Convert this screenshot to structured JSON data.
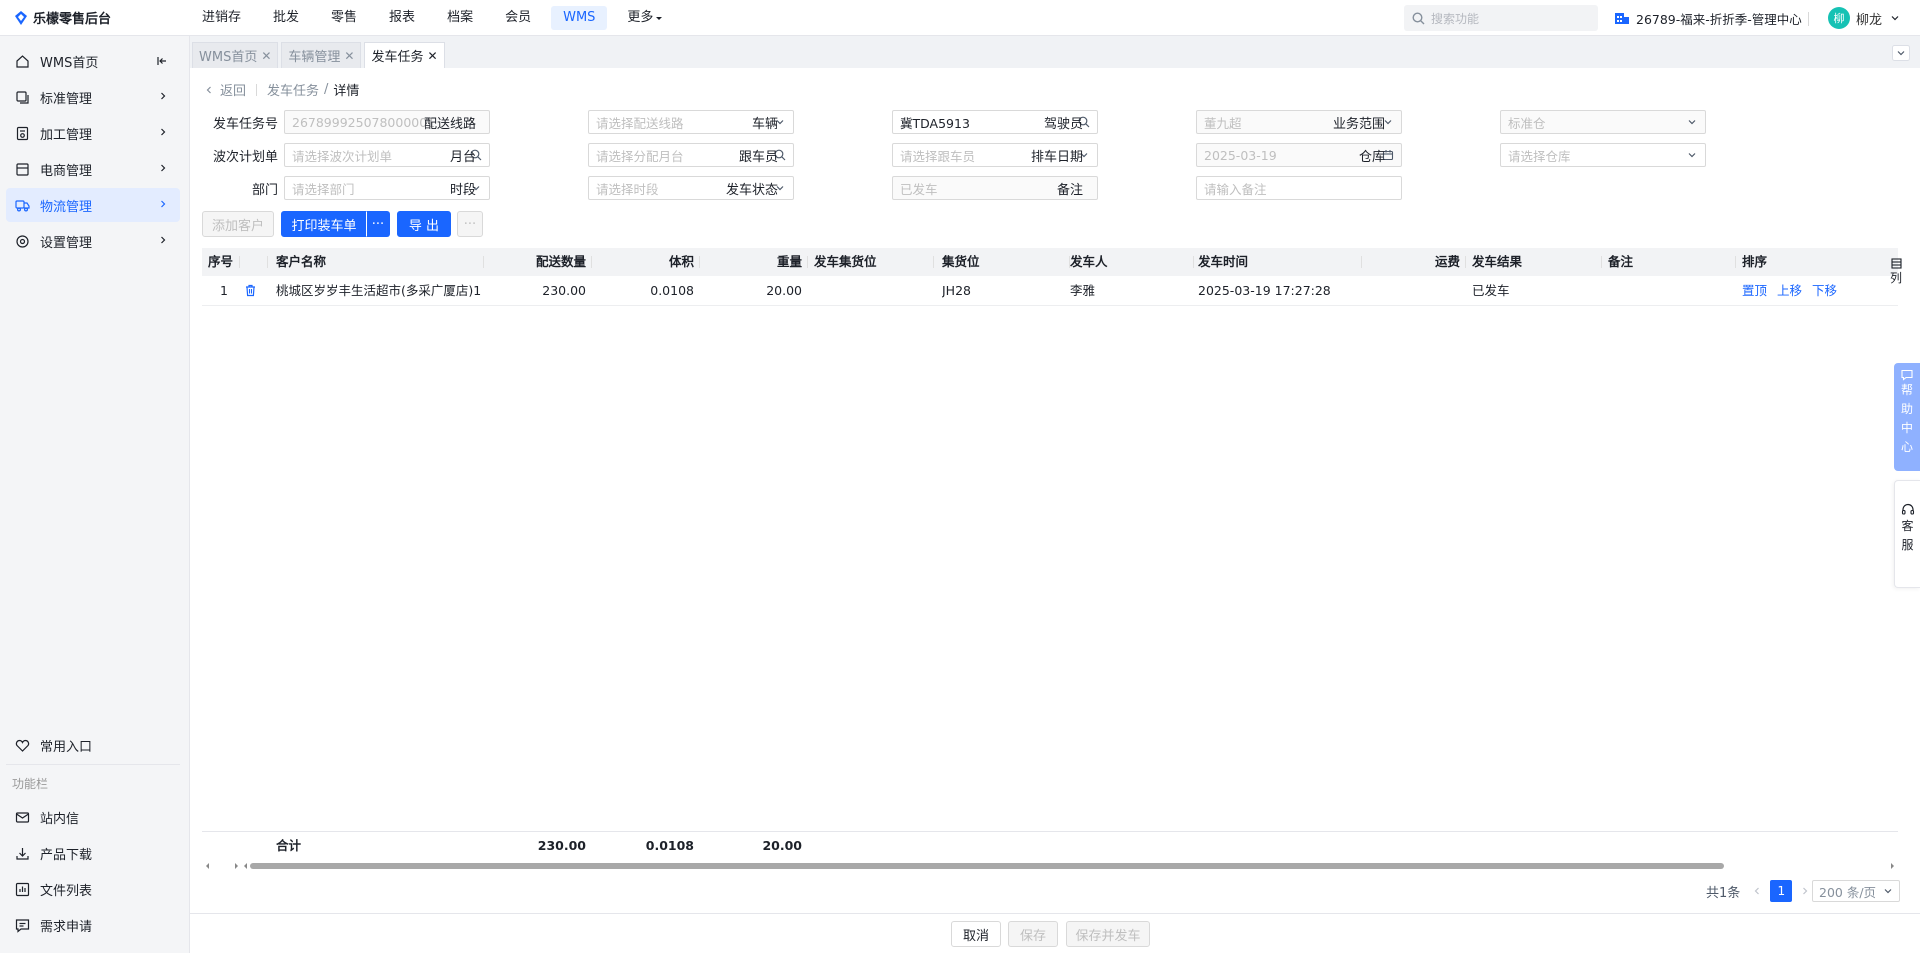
{
  "app": {
    "title": "乐檬零售后台"
  },
  "topnav": [
    {
      "label": "进销存"
    },
    {
      "label": "批发"
    },
    {
      "label": "零售"
    },
    {
      "label": "报表"
    },
    {
      "label": "档案"
    },
    {
      "label": "会员"
    },
    {
      "label": "WMS",
      "active": true
    },
    {
      "label": "更多"
    }
  ],
  "search": {
    "placeholder": "搜索功能"
  },
  "store": {
    "name": "26789-福来-折折季-管理中心"
  },
  "user": {
    "avatar_text": "柳",
    "name": "柳龙"
  },
  "sidebar": {
    "items": [
      {
        "label": "WMS首页",
        "icon": "home-icon"
      },
      {
        "label": "标准管理",
        "icon": "copy-icon"
      },
      {
        "label": "加工管理",
        "icon": "file-icon"
      },
      {
        "label": "电商管理",
        "icon": "shop-icon"
      },
      {
        "label": "物流管理",
        "icon": "truck-icon",
        "active": true
      },
      {
        "label": "设置管理",
        "icon": "gear-icon"
      }
    ],
    "favorites": "常用入口",
    "section_label": "功能栏",
    "bottom_items": [
      {
        "label": "站内信",
        "icon": "mail-icon"
      },
      {
        "label": "产品下载",
        "icon": "download-icon"
      },
      {
        "label": "文件列表",
        "icon": "chart-icon"
      },
      {
        "label": "需求申请",
        "icon": "message-icon"
      }
    ]
  },
  "tabs": [
    {
      "label": "WMS首页"
    },
    {
      "label": "车辆管理"
    },
    {
      "label": "发车任务",
      "active": true
    }
  ],
  "breadcrumb": {
    "back": "返回",
    "parent": "发车任务",
    "sep": "/",
    "current": "详情"
  },
  "form": {
    "task_no": {
      "label": "发车任务号",
      "value": "267899925078000001"
    },
    "route": {
      "label": "配送线路",
      "placeholder": "请选择配送线路"
    },
    "vehicle": {
      "label": "车辆",
      "value": "冀TDA5913"
    },
    "driver": {
      "label": "驾驶员",
      "value": "董九超"
    },
    "biz_scope": {
      "label": "业务范围",
      "value": "标准仓"
    },
    "wave": {
      "label": "波次计划单",
      "placeholder": "请选择波次计划单"
    },
    "dock": {
      "label": "月台",
      "placeholder": "请选择分配月台"
    },
    "escort": {
      "label": "跟车员",
      "placeholder": "请选择跟车员"
    },
    "date": {
      "label": "排车日期",
      "value": "2025-03-19"
    },
    "warehouse": {
      "label": "仓库",
      "placeholder": "请选择仓库"
    },
    "dept": {
      "label": "部门",
      "placeholder": "请选择部门"
    },
    "period": {
      "label": "时段",
      "placeholder": "请选择时段"
    },
    "status": {
      "label": "发车状态",
      "value": "已发车"
    },
    "remark": {
      "label": "备注",
      "placeholder": "请输入备注"
    }
  },
  "toolbar": {
    "add_customer": "添加客户",
    "print": "打印装车单",
    "print_more": "···",
    "export": "导 出",
    "more": "···"
  },
  "table": {
    "headers": {
      "seq": "序号",
      "customer": "客户名称",
      "qty": "配送数量",
      "volume": "体积",
      "weight": "重量",
      "dispatch_spot": "发车集货位",
      "spot": "集货位",
      "sender": "发车人",
      "time": "发车时间",
      "freight": "运费",
      "result": "发车结果",
      "note": "备注",
      "sort": "排序"
    },
    "rows": [
      {
        "seq": "1",
        "customer": "桃城区岁岁丰生活超市(多采广厦店)1",
        "qty": "230.00",
        "volume": "0.0108",
        "weight": "20.00",
        "dispatch_spot": "",
        "spot": "JH28",
        "sender": "李雅",
        "time": "2025-03-19 17:27:28",
        "freight": "",
        "result": "已发车",
        "note": "",
        "actions": [
          "置顶",
          "上移",
          "下移"
        ]
      }
    ],
    "total": {
      "label": "合计",
      "qty": "230.00",
      "volume": "0.0108",
      "weight": "20.00"
    },
    "column_setting": "列"
  },
  "pagination": {
    "total": "共1条",
    "current": "1",
    "page_size": "200 条/页"
  },
  "footer": {
    "cancel": "取消",
    "save": "保存",
    "save_dispatch": "保存并发车"
  },
  "floats": {
    "help": [
      "帮",
      "助",
      "中",
      "心"
    ],
    "service": [
      "客",
      "服"
    ]
  },
  "colors": {
    "primary": "#1a66ff",
    "sidebar_active_bg": "#e3ecff",
    "help_bg": "#8fb1ff"
  }
}
